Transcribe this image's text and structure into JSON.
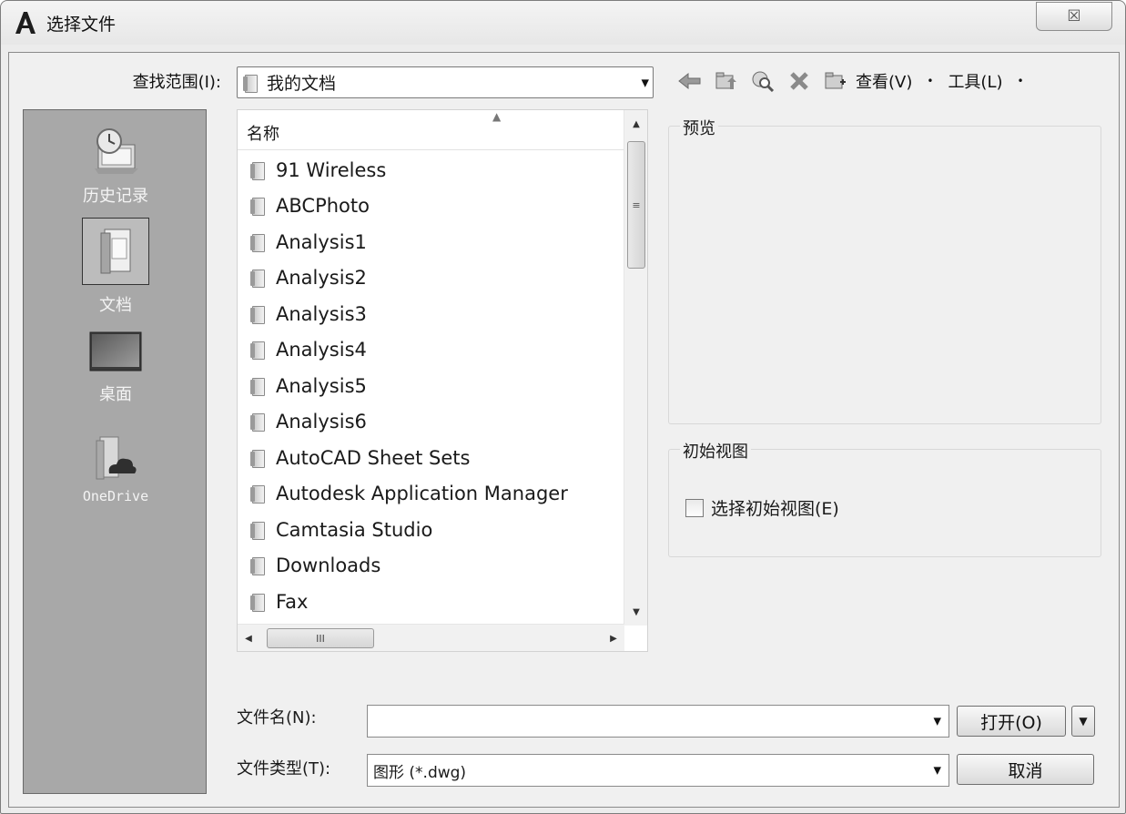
{
  "window": {
    "title": "选择文件",
    "close_glyph": "☒"
  },
  "lookin": {
    "label": "查找范围(I):",
    "value": "我的文档"
  },
  "toolbar": {
    "icons": [
      "back-arrow-icon",
      "up-folder-icon",
      "search-web-icon",
      "delete-icon",
      "new-folder-icon"
    ],
    "view_label": "查看(V)",
    "tools_label": "工具(L)"
  },
  "places": [
    {
      "label": "历史记录",
      "icon": "history-icon"
    },
    {
      "label": "文档",
      "icon": "documents-icon"
    },
    {
      "label": "桌面",
      "icon": "desktop-icon"
    },
    {
      "label": "OneDrive",
      "icon": "onedrive-icon"
    }
  ],
  "filelist": {
    "column_name": "名称",
    "items": [
      "91 Wireless",
      "ABCPhoto",
      "Analysis1",
      "Analysis2",
      "Analysis3",
      "Analysis4",
      "Analysis5",
      "Analysis6",
      "AutoCAD Sheet Sets",
      "Autodesk Application Manager",
      "Camtasia Studio",
      "Downloads",
      "Fax"
    ]
  },
  "preview": {
    "title": "预览"
  },
  "initial_view": {
    "title": "初始视图",
    "checkbox_label": "选择初始视图(E)",
    "checked": false
  },
  "filename": {
    "label": "文件名(N):",
    "value": "",
    "open_button": "打开(O)"
  },
  "filetype": {
    "label": "文件类型(T):",
    "value": "图形 (*.dwg)",
    "cancel_button": "取消"
  }
}
